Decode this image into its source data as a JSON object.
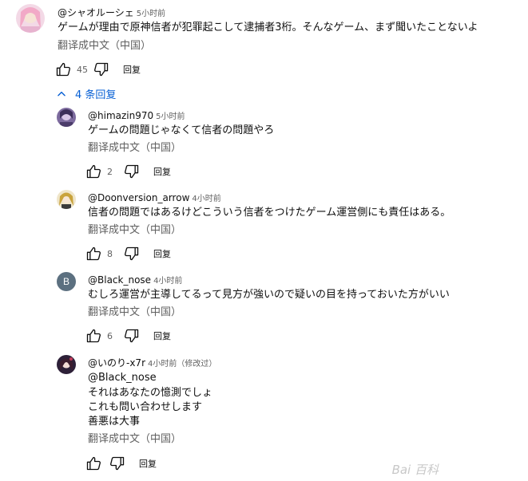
{
  "comment": {
    "author": "@シャオルーシェ",
    "time": "5小时前",
    "text": "ゲームが理由で原神信者が犯罪起こして逮捕者3桁。そんなゲーム、まず聞いたことないよ",
    "translate": "翻译成中文（中国）",
    "likes": "45",
    "reply_label": "回复"
  },
  "replies_toggle": {
    "label": "4 条回复"
  },
  "replies": [
    {
      "author": "@himazin970",
      "time": "5小时前",
      "lines": [
        "ゲームの問題じゃなくて信者の問題やろ"
      ],
      "translate": "翻译成中文（中国）",
      "likes": "2",
      "reply_label": "回复"
    },
    {
      "author": "@Doonversion_arrow",
      "time": "4小时前",
      "lines": [
        "信者の問題ではあるけどこういう信者をつけたゲーム運営側にも責任はある。"
      ],
      "translate": "翻译成中文（中国）",
      "likes": "8",
      "reply_label": "回复"
    },
    {
      "author": "@Black_nose",
      "time": "4小时前",
      "avatar_letter": "B",
      "lines": [
        "むしろ運営が主導してるって見方が強いので疑いの目を持っておいた方がいい"
      ],
      "translate": "翻译成中文（中国）",
      "likes": "6",
      "reply_label": "回复"
    },
    {
      "author": "@いのり-x7r",
      "time": "4小时前（修改过）",
      "lines": [
        "@Black_nose",
        "それはあなたの憶測でしょ",
        "これも問い合わせします",
        "善悪は大事"
      ],
      "translate": "翻译成中文（中国）",
      "likes": "",
      "reply_label": "回复"
    }
  ],
  "watermark": "Bai 百科",
  "colors": {
    "link": "#065fd4",
    "muted": "#606060",
    "text": "#0f0f0f"
  }
}
